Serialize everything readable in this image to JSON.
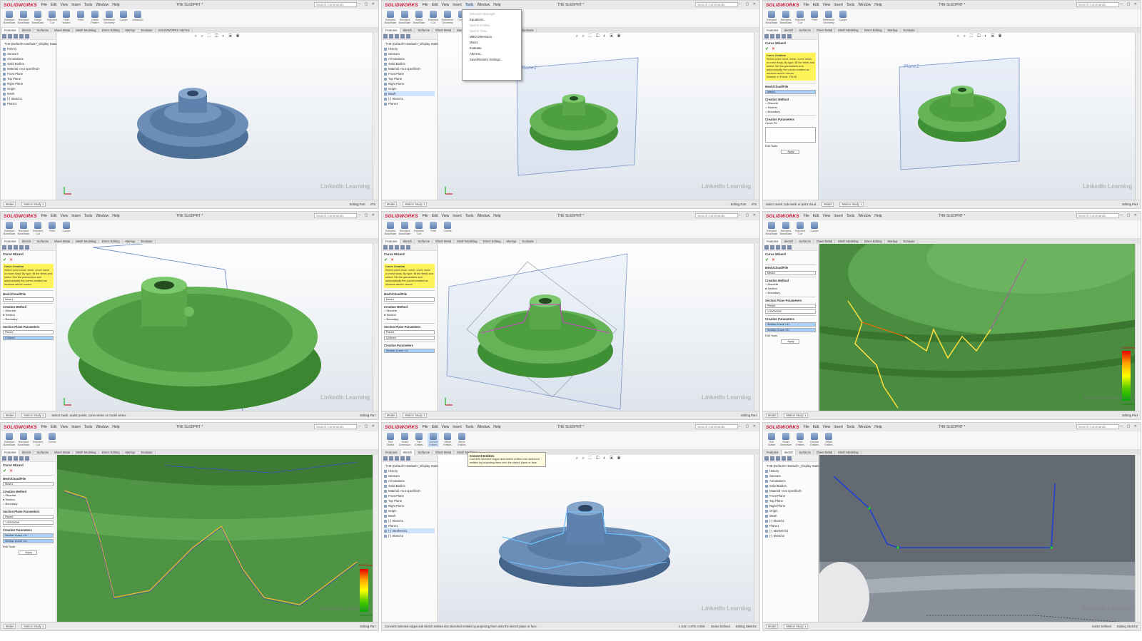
{
  "app": {
    "logo": "SOLIDWORKS",
    "title": "THE SLEDPRT *",
    "search_placeholder": "Search Commands",
    "menu": [
      "File",
      "Edit",
      "View",
      "Insert",
      "Tools",
      "Window",
      "Help"
    ]
  },
  "ribbon": [
    "Extruded Boss/Base",
    "Revolved Boss/Base",
    "Swept Boss/Base",
    "Lofted Boss/Base",
    "Boundary Boss/Base",
    "Extruded Cut",
    "Hole Wizard",
    "Revolved Cut",
    "Fillet",
    "Linear Pattern",
    "Rib",
    "Draft",
    "Shell",
    "Reference Geometry",
    "Curves",
    "Instant3D"
  ],
  "tabs": [
    "Features",
    "Sketch",
    "Surfaces",
    "Sheet Metal",
    "Mesh Modeling",
    "Direct Editing",
    "Markup",
    "Evaluate",
    "SOLIDWORKS Add-Ins"
  ],
  "tree": [
    "THE (Default<<Default>_Display State 1>)",
    "History",
    "Sensors",
    "Annotations",
    "Solid Bodies",
    "Material <not specified>",
    "Front Plane",
    "Top Plane",
    "Right Plane",
    "Origin",
    "Mesh",
    "(-) Sketch1",
    "Plane1"
  ],
  "tree_sketch": [
    "THE (Default<<Default>_Display State 1>)",
    "History",
    "Sensors",
    "Annotations",
    "Solid Bodies",
    "Material <not specified>",
    "Front Plane",
    "Top Plane",
    "Right Plane",
    "Origin",
    "Mesh",
    "(-) Sketch1",
    "Plane1",
    "(-) 3DSketch1",
    "(-) Sketch2"
  ],
  "pm": {
    "title": "Curve Wizard",
    "msg_title": "Curve Creation",
    "msg": "Select point cloud, mesh, curve mesh or mesh body, By type, fill the fields and select. Set the parameters and automatically the curves created as sections and/or curves",
    "points": "Number of Points: 79108",
    "mesh_file": "Mesh/Cloud/File",
    "mesh_value": "Mesh1",
    "creation_method": "Creation Method",
    "methods": [
      "Discrete",
      "Section",
      "Boundary"
    ],
    "plane_params": "Section Plane Parameters",
    "plane_value": "Plane1",
    "param_a": "0.00mm",
    "param_b": "1.00000000",
    "curve_params": "Creation Parameters",
    "curve_fit": "Curve Fit",
    "section_curves": [
      "Section Curve <1>",
      "Section Curve <2>"
    ],
    "edit_tools": "Edit Tools",
    "apply": "Apply"
  },
  "tools_menu": {
    "items": [
      "Selection Manager",
      "Equations...",
      "Sketch Entities",
      "Sketch Tools",
      "MBD Dimension",
      "Macro",
      "Evaluate",
      "Add-Ins...",
      "Save/Restore Settings..."
    ]
  },
  "tooltip": {
    "title": "Convert Entities",
    "body": "Converts selected edges and sketch entities into sketched entities by projecting them onto the sketch plane or face."
  },
  "status": {
    "model_tab": "Model",
    "motion_tab": "Motion Study 1",
    "editing_part": "Editing Part",
    "ips": "IPS",
    "select_hint": "Select mesh, sub-mesh or point cloud",
    "select_hint2": "Select mesh, scalar points, curve vertex or model vertex",
    "convert_hint": "Converts selected edges and sketch entities into sketched entities by projecting them onto the sketch plane or face.",
    "under_defined": "Under Defined",
    "editing_sketch": "Editing Sketch2",
    "coords": "-1.44in   1.97in  0.00in"
  },
  "legend": {
    "max": "0.0970mm",
    "min": "0.0000mm"
  },
  "watermark": "LinkedIn Learning",
  "plane_label": "Plane1",
  "colors": {
    "accent": "#c8102e",
    "mesh_blue": "#5a7fa8",
    "mesh_green": "#5fa84a",
    "highlight": "#fff35c"
  }
}
